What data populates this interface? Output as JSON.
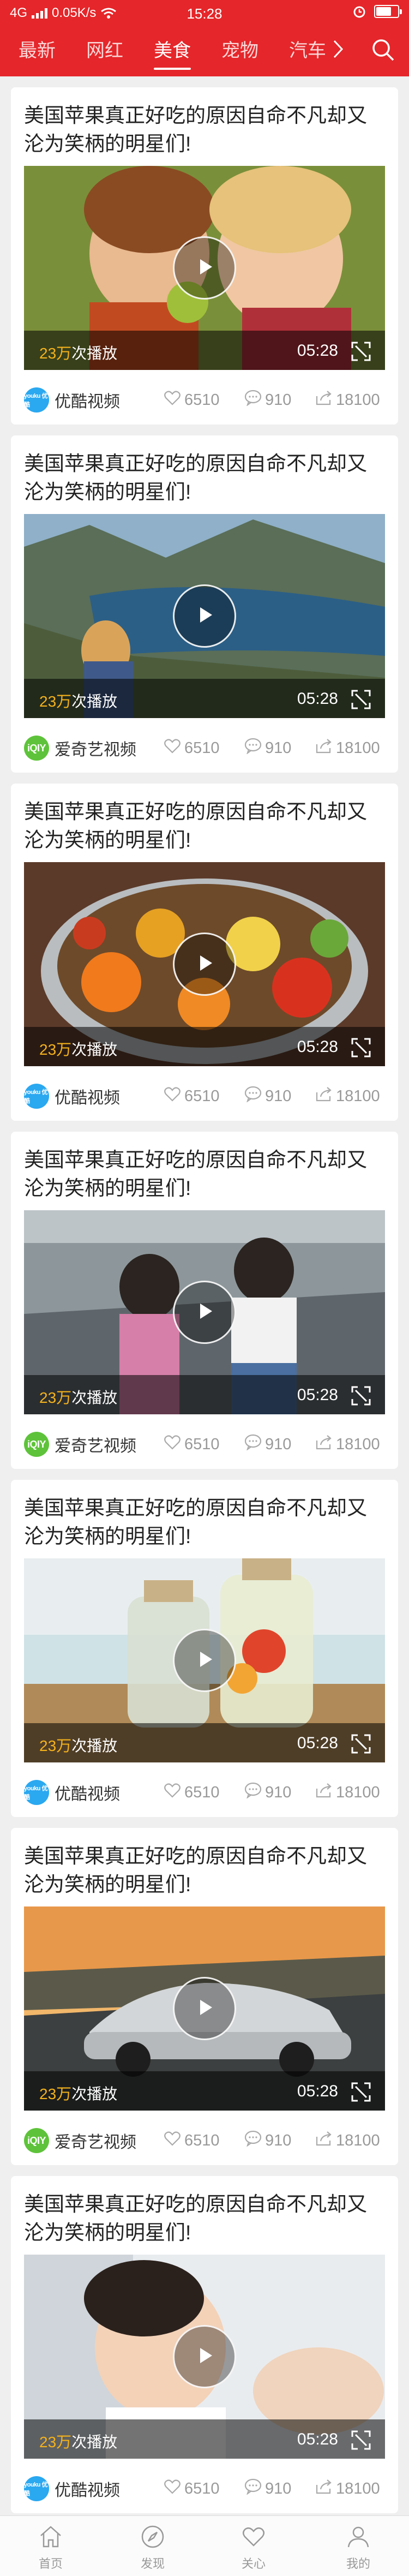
{
  "status_bar": {
    "network": "4G",
    "speed": "0.05K/s",
    "time": "15:28",
    "battery_level": 0.7
  },
  "tabs": [
    {
      "label": "最新",
      "active": false
    },
    {
      "label": "网红",
      "active": false
    },
    {
      "label": "美食",
      "active": true
    },
    {
      "label": "宠物",
      "active": false
    },
    {
      "label": "汽车",
      "active": false
    }
  ],
  "icons": {
    "more": "chevron-right-icon",
    "search": "search-icon",
    "play": "play-icon",
    "fullscreen": "fullscreen-icon",
    "like": "heart-icon",
    "comment": "comment-icon",
    "share": "share-icon"
  },
  "colors": {
    "brand": "#e5262a",
    "play_count_number": "#f5b21b",
    "youku": "#2aa8f0",
    "iqiyi": "#5ec33a"
  },
  "cards": [
    {
      "title": "美国苹果真正好吃的原因自命不凡却又沦为笑柄的明星们!",
      "thumbnail": "children-laughing",
      "plays_num": "23万",
      "plays_suffix": "次播放",
      "duration": "05:28",
      "source": "优酷视频",
      "source_logo": "youku",
      "logo_text": "youku 优酷",
      "likes": "6510",
      "comments": "910",
      "shares": "18100"
    },
    {
      "title": "美国苹果真正好吃的原因自命不凡却又沦为笑柄的明星们!",
      "thumbnail": "girl-overlooking-fjord",
      "plays_num": "23万",
      "plays_suffix": "次播放",
      "duration": "05:28",
      "source": "爱奇艺视频",
      "source_logo": "iqiyi",
      "logo_text": "iQIY",
      "likes": "6510",
      "comments": "910",
      "shares": "18100"
    },
    {
      "title": "美国苹果真正好吃的原因自命不凡却又沦为笑柄的明星们!",
      "thumbnail": "bowl-of-vegetables",
      "plays_num": "23万",
      "plays_suffix": "次播放",
      "duration": "05:28",
      "source": "优酷视频",
      "source_logo": "youku",
      "logo_text": "youku 优酷",
      "likes": "6510",
      "comments": "910",
      "shares": "18100"
    },
    {
      "title": "美国苹果真正好吃的原因自命不凡却又沦为笑柄的明星们!",
      "thumbnail": "two-kids-on-road",
      "plays_num": "23万",
      "plays_suffix": "次播放",
      "duration": "05:28",
      "source": "爱奇艺视频",
      "source_logo": "iqiyi",
      "logo_text": "iQIY",
      "likes": "6510",
      "comments": "910",
      "shares": "18100"
    },
    {
      "title": "美国苹果真正好吃的原因自命不凡却又沦为笑柄的明星们!",
      "thumbnail": "glass-jars-on-table",
      "plays_num": "23万",
      "plays_suffix": "次播放",
      "duration": "05:28",
      "source": "优酷视频",
      "source_logo": "youku",
      "logo_text": "youku 优酷",
      "likes": "6510",
      "comments": "910",
      "shares": "18100"
    },
    {
      "title": "美国苹果真正好吃的原因自命不凡却又沦为笑柄的明星们!",
      "thumbnail": "silver-car-on-road",
      "plays_num": "23万",
      "plays_suffix": "次播放",
      "duration": "05:28",
      "source": "爱奇艺视频",
      "source_logo": "iqiyi",
      "logo_text": "iQIY",
      "likes": "6510",
      "comments": "910",
      "shares": "18100"
    },
    {
      "title": "美国苹果真正好吃的原因自命不凡却又沦为笑柄的明星们!",
      "thumbnail": "baby-with-hand",
      "plays_num": "23万",
      "plays_suffix": "次播放",
      "duration": "05:28",
      "source": "优酷视频",
      "source_logo": "youku",
      "logo_text": "youku 优酷",
      "likes": "6510",
      "comments": "910",
      "shares": "18100"
    }
  ],
  "bottom_nav": [
    {
      "label": "首页",
      "icon": "home-icon"
    },
    {
      "label": "发现",
      "icon": "compass-icon"
    },
    {
      "label": "关心",
      "icon": "heart-icon"
    },
    {
      "label": "我的",
      "icon": "user-icon"
    }
  ]
}
